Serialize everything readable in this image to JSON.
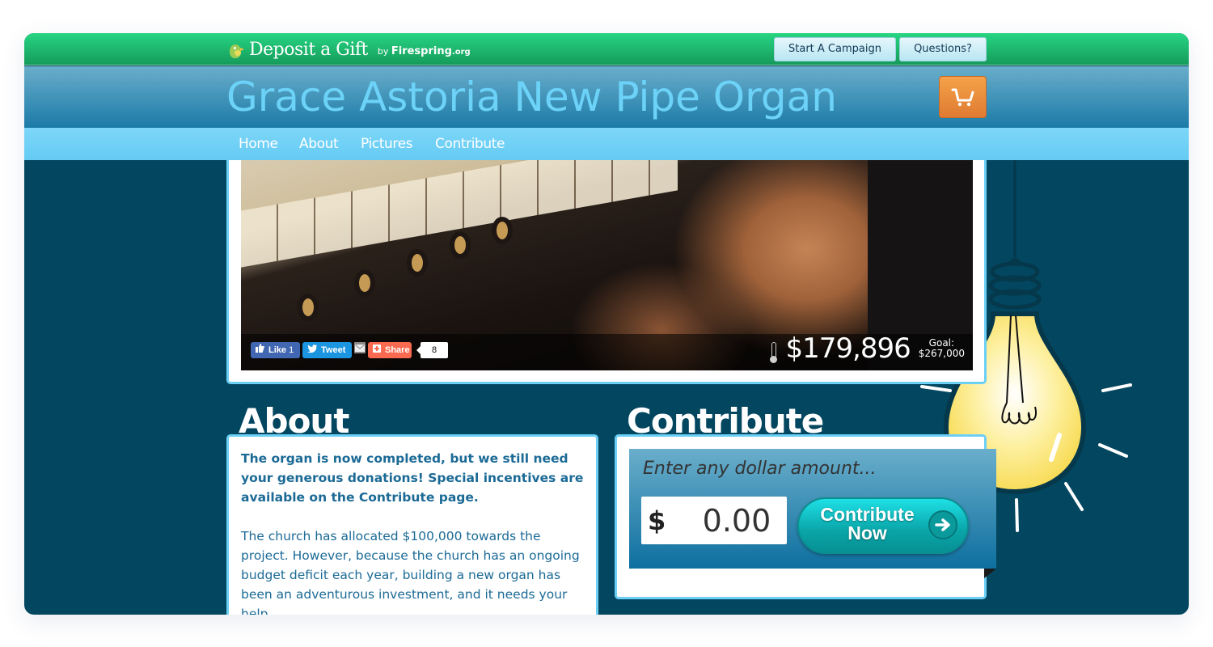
{
  "brand": {
    "name": "Deposit a Gift",
    "by_prefix": "by",
    "by_name": "Firespring",
    "by_suffix": ".org"
  },
  "header": {
    "buttons": {
      "start_campaign": "Start A Campaign",
      "questions": "Questions?"
    },
    "title": "Grace Astoria New Pipe Organ",
    "cart_icon": "shopping-cart-icon"
  },
  "nav": {
    "items": [
      {
        "label": "Home"
      },
      {
        "label": "About"
      },
      {
        "label": "Pictures"
      },
      {
        "label": "Contribute"
      }
    ]
  },
  "hero": {
    "image_alt": "Hand playing pipe organ keys",
    "social": {
      "like_label": "Like",
      "like_count": "1",
      "tweet_label": "Tweet",
      "email_icon": "envelope-icon",
      "share_label": "Share",
      "share_count": "8"
    },
    "raised": "$179,896",
    "goal_label": "Goal:",
    "goal_amount": "$267,000",
    "progress_fraction": 0.674
  },
  "about": {
    "heading": "About",
    "paragraph1": "The organ is now completed, but we still need your generous donations! Special incentives are available on the Contribute page.",
    "paragraph2": "The church has allocated $100,000 towards the project. However, because the church has an ongoing budget deficit each year, building a new organ has been an adventurous investment, and it needs your help."
  },
  "contribute": {
    "heading": "Contribute",
    "prompt": "Enter any dollar amount...",
    "currency_symbol": "$",
    "amount_value": "0.00",
    "button_line1": "Contribute",
    "button_line2": "Now"
  },
  "colors": {
    "topbar_green": "#1fbf72",
    "title_blue": "#6cd2f8",
    "nav_blue": "#72d1f6",
    "page_bg": "#02465f",
    "cart_orange": "#ec8d3d",
    "card_border": "#6ccff6",
    "text_blue": "#1b6a96",
    "button_teal": "#12c2c6"
  }
}
